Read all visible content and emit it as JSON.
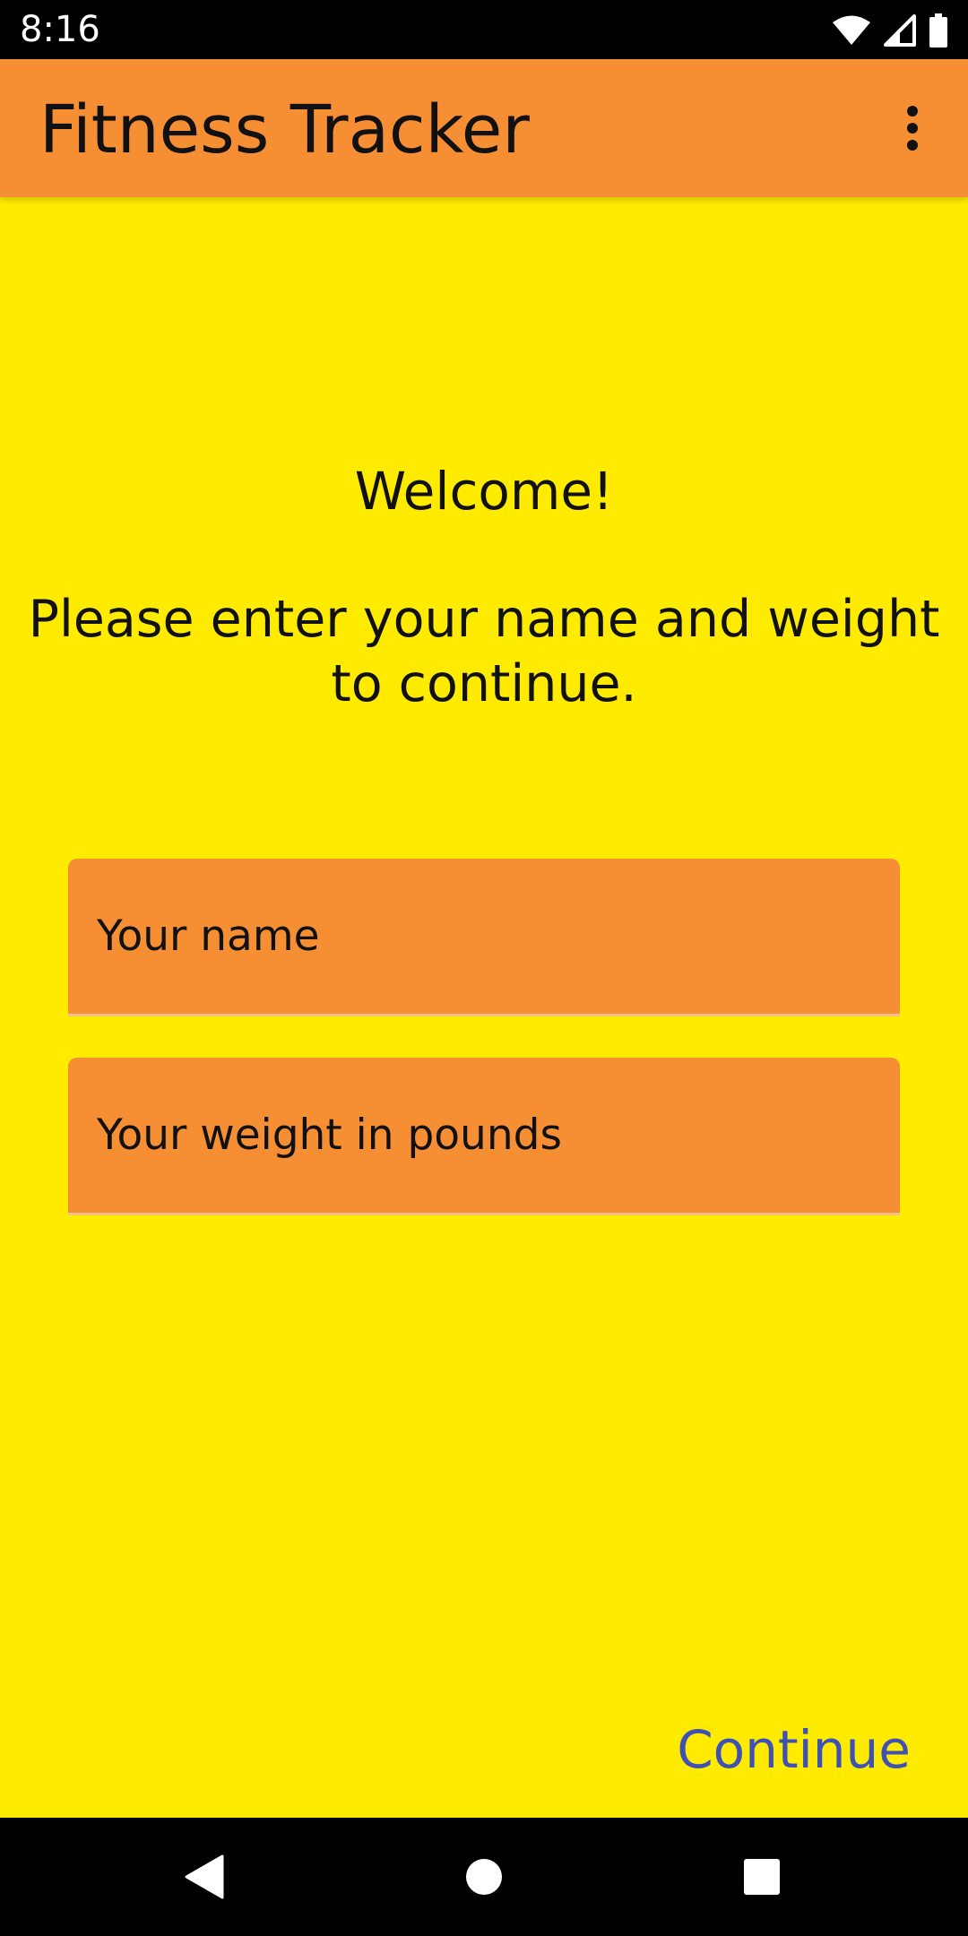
{
  "status_bar": {
    "time": "8:16",
    "icons": [
      "wifi-icon",
      "cellular-signal-icon",
      "battery-icon"
    ]
  },
  "app_bar": {
    "title": "Fitness Tracker",
    "menu_icon": "more-vert-icon",
    "background_color": "#F68E34"
  },
  "content": {
    "background_color": "#FFEB00",
    "welcome": "Welcome!",
    "instructions": "Please enter your name and weight to continue."
  },
  "form": {
    "name_field": {
      "placeholder": "Your name",
      "value": ""
    },
    "weight_field": {
      "placeholder": "Your weight in pounds",
      "value": ""
    }
  },
  "actions": {
    "continue_label": "Continue",
    "accent_color": "#3F51B5"
  },
  "nav_bar": {
    "icons": [
      "back-icon",
      "home-icon",
      "recents-icon"
    ]
  }
}
